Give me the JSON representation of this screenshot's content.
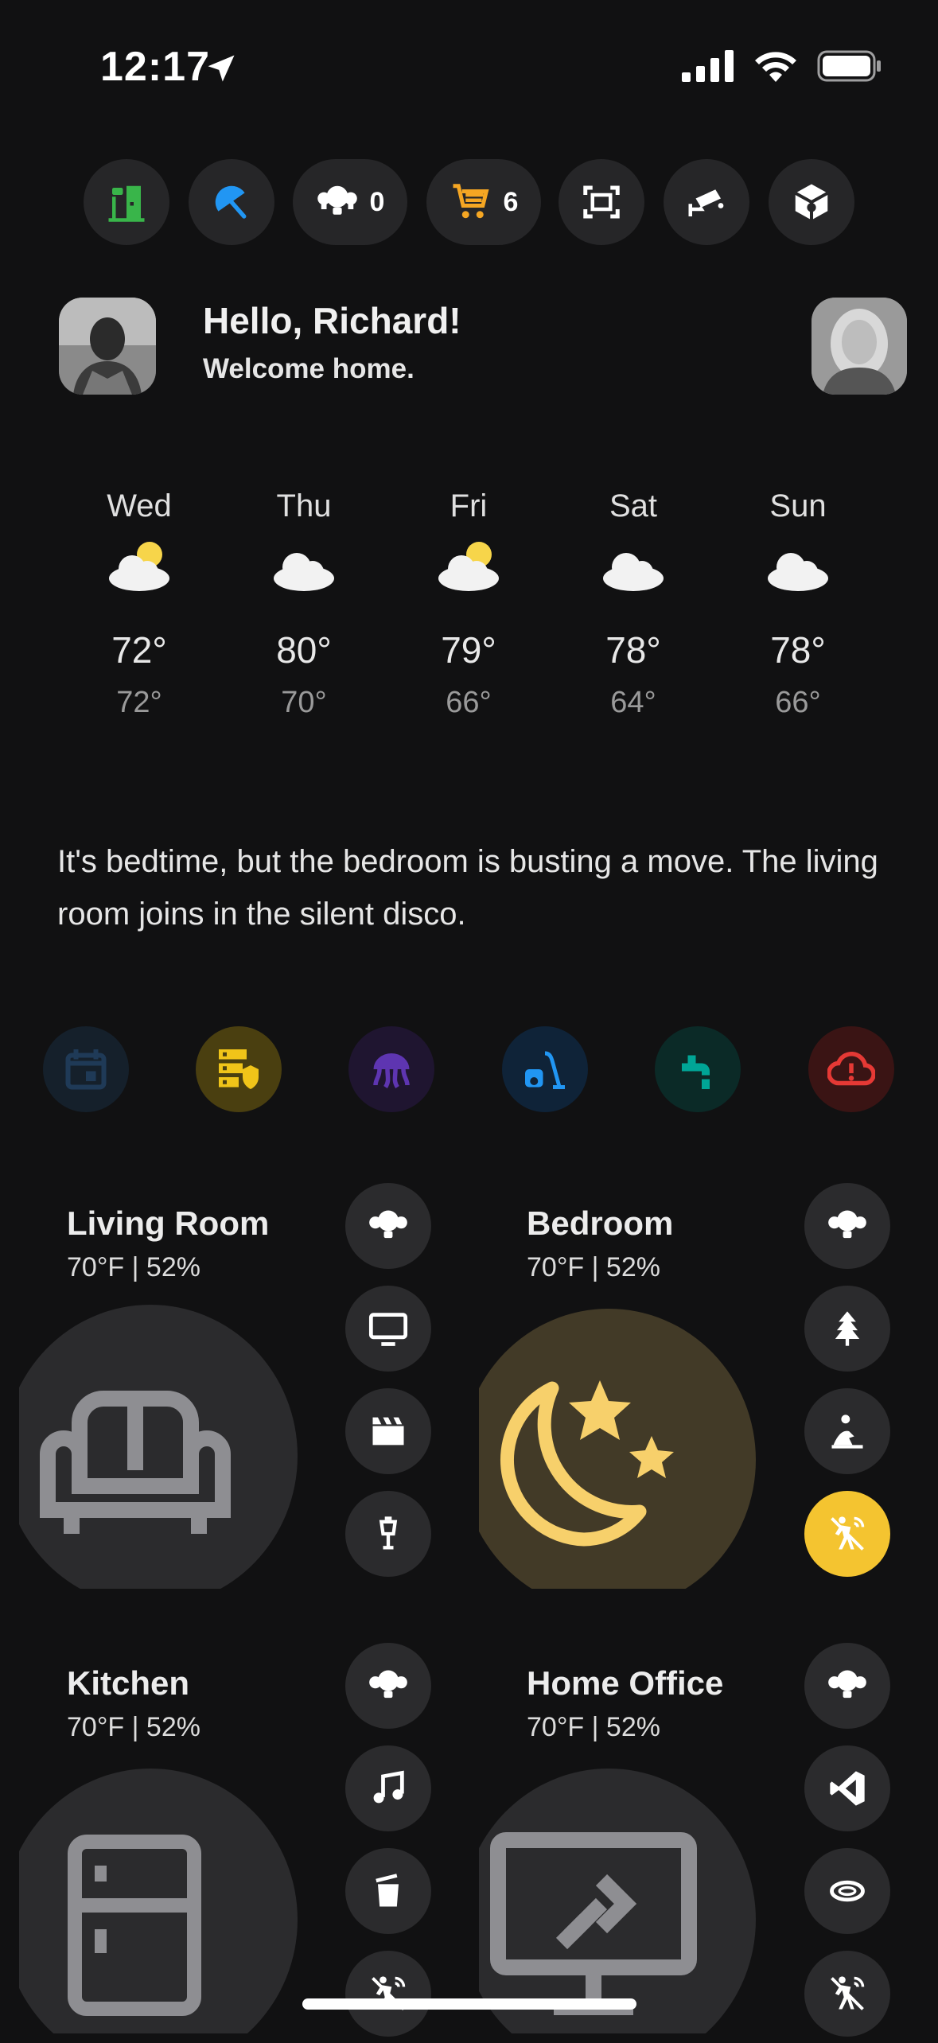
{
  "status_bar": {
    "time": "12:17"
  },
  "chips": [
    {
      "icon": "door-open-icon",
      "color": "#39b54a",
      "count": ""
    },
    {
      "icon": "umbrella-icon",
      "color": "#2196f3",
      "count": ""
    },
    {
      "icon": "lightbulb-group-icon",
      "color": "#ffffff",
      "count": "0"
    },
    {
      "icon": "cart-icon",
      "color": "#f5a623",
      "count": "6"
    },
    {
      "icon": "scan-frame-icon",
      "color": "#ffffff",
      "count": ""
    },
    {
      "icon": "cctv-camera-icon",
      "color": "#ffffff",
      "count": ""
    },
    {
      "icon": "package-icon",
      "color": "#ffffff",
      "count": ""
    }
  ],
  "greeting": {
    "title": "Hello, Richard!",
    "subtitle": "Welcome home."
  },
  "weather": [
    {
      "day": "Wed",
      "icon": "partly-cloudy-icon",
      "high": "72°",
      "low": "72°"
    },
    {
      "day": "Thu",
      "icon": "cloudy-icon",
      "high": "80°",
      "low": "70°"
    },
    {
      "day": "Fri",
      "icon": "partly-cloudy-icon",
      "high": "79°",
      "low": "66°"
    },
    {
      "day": "Sat",
      "icon": "cloudy-icon",
      "high": "78°",
      "low": "64°"
    },
    {
      "day": "Sun",
      "icon": "cloudy-icon",
      "high": "78°",
      "low": "66°"
    }
  ],
  "summary": "It's bedtime, but the bedroom is busting a move. The living room joins in the silent disco.",
  "quick_actions": [
    {
      "icon": "calendar-icon",
      "color": "#1f3a57",
      "bg": "#15202b"
    },
    {
      "icon": "server-shield-icon",
      "color": "#f0c419",
      "bg": "#4a3f10"
    },
    {
      "icon": "jellyfish-icon",
      "color": "#5e35b1",
      "bg": "#1f1530"
    },
    {
      "icon": "vacuum-icon",
      "color": "#2196f3",
      "bg": "#0f2338"
    },
    {
      "icon": "faucet-icon",
      "color": "#00a596",
      "bg": "#0b2a27"
    },
    {
      "icon": "cloud-alert-icon",
      "color": "#e53935",
      "bg": "#3a1414"
    }
  ],
  "rooms": [
    {
      "name": "Living Room",
      "meta": "70°F | 52%",
      "main_icon": "sofa-icon",
      "buttons": [
        "lightbulb-group-icon",
        "tv-icon",
        "clapperboard-icon",
        "lamp-post-icon"
      ]
    },
    {
      "name": "Bedroom",
      "meta": "70°F | 52%",
      "main_icon": "moon-stars-icon",
      "buttons": [
        "lightbulb-group-icon",
        "pine-tree-icon",
        "sleep-icon",
        "motion-sensor-icon"
      ]
    },
    {
      "name": "Kitchen",
      "meta": "70°F | 52%",
      "main_icon": "fridge-icon",
      "buttons": [
        "lightbulb-group-icon",
        "music-note-icon",
        "trash-can-icon",
        "motion-sensor-icon"
      ]
    },
    {
      "name": "Home Office",
      "meta": "70°F | 52%",
      "main_icon": "remote-desktop-icon",
      "buttons": [
        "lightbulb-group-icon",
        "vscode-icon",
        "ring-light-icon",
        "motion-sensor-icon"
      ]
    }
  ],
  "colors": {
    "accent_yellow": "#f4c430",
    "card_bg": "#2b2b2d",
    "bedroom_bg": "#423a27"
  }
}
